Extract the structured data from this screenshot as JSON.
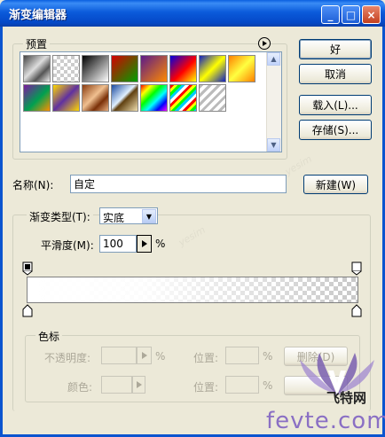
{
  "window": {
    "title": "渐变编辑器"
  },
  "titlebar_buttons": {
    "minimize": "_",
    "maximize": "□",
    "close": "×"
  },
  "presets": {
    "label": "预置",
    "menu_icon": "circle-arrow-icon",
    "swatches": [
      "metal-silver",
      "transparent-checker",
      "black-white",
      "red-green",
      "violet-orange",
      "blue-red-yellow",
      "blue-yellow-blue",
      "orange-yellow-orange",
      "violet-green-orange",
      "yellow-violet-yellow",
      "copper",
      "chrome",
      "spectrum",
      "rainbow-transparent",
      "transparent-stripes"
    ]
  },
  "buttons": {
    "ok": "好",
    "cancel": "取消",
    "load": "载入(L)...",
    "save": "存储(S)...",
    "new": "新建(W)",
    "delete": "删除(D)"
  },
  "name": {
    "label": "名称(N):",
    "value": "自定"
  },
  "gradient_type": {
    "label": "渐变类型(T):",
    "value": "实底"
  },
  "smoothness": {
    "label": "平滑度(M):",
    "value": "100",
    "unit": "%"
  },
  "color_stops": {
    "label": "色标",
    "opacity_label": "不透明度:",
    "opacity_unit": "%",
    "location_label_1": "位置:",
    "location_unit_1": "%",
    "color_label": "颜色:",
    "location_label_2": "位置:",
    "location_unit_2": "%"
  },
  "watermark": {
    "text_1": "fevte.com",
    "text_2": "飞特网"
  }
}
